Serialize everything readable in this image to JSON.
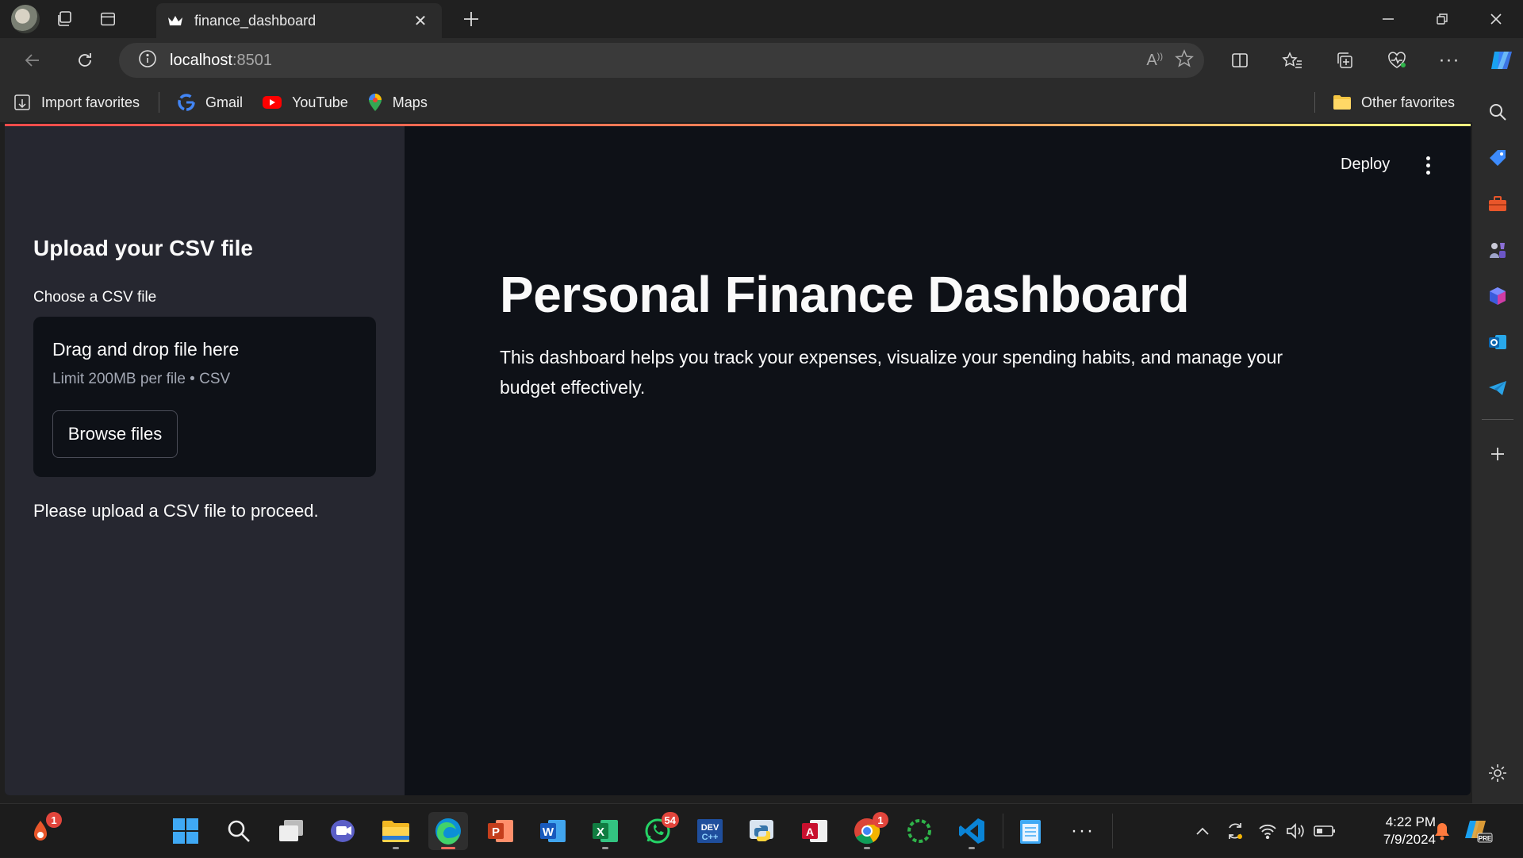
{
  "browser": {
    "tab_title": "finance_dashboard",
    "url_host": "localhost",
    "url_port": ":8501",
    "favorites": [
      {
        "label": "Import favorites",
        "icon": "import-favorites-icon"
      },
      {
        "label": "Gmail",
        "icon": "google-icon"
      },
      {
        "label": "YouTube",
        "icon": "youtube-icon"
      },
      {
        "label": "Maps",
        "icon": "maps-icon"
      }
    ],
    "other_favorites": "Other favorites"
  },
  "app": {
    "toolbar": {
      "deploy_label": "Deploy"
    },
    "sidebar": {
      "header": "Upload your CSV file",
      "uploader_label": "Choose a CSV file",
      "dropzone_title": "Drag and drop file here",
      "dropzone_limit": "Limit 200MB per file • CSV",
      "browse_button": "Browse files",
      "info_message": "Please upload a CSV file to proceed."
    },
    "main": {
      "title": "Personal Finance Dashboard",
      "description": "This dashboard helps you track your expenses, visualize your spending habits, and manage your budget effectively."
    }
  },
  "taskbar": {
    "badges": {
      "notifications_app": "1",
      "whatsapp": "54",
      "chrome": "1"
    },
    "clock_time": "4:22 PM",
    "clock_date": "7/9/2024"
  },
  "colors": {
    "page_bg": "#0e1117",
    "sidebar_bg": "#262730",
    "accent": "#ff4b4b",
    "text": "#fafafa"
  }
}
